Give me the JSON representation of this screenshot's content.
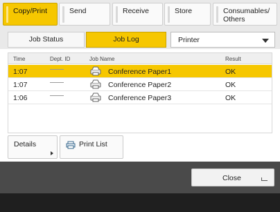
{
  "tabs": [
    {
      "label": "Copy/Print",
      "active": true
    },
    {
      "label": "Send",
      "active": false
    },
    {
      "label": "Receive",
      "active": false
    },
    {
      "label": "Store",
      "active": false
    },
    {
      "label": "Consumables/\nOthers",
      "active": false
    }
  ],
  "subtabs": {
    "job_status": "Job Status",
    "job_log": "Job Log",
    "printer_select": "Printer"
  },
  "table": {
    "headers": {
      "time": "Time",
      "dept": "Dept. ID",
      "job": "Job Name",
      "result": "Result"
    },
    "rows": [
      {
        "time": "1:07",
        "dept": "——",
        "job": "Conference Paper1",
        "result": "OK",
        "selected": true,
        "icon": "print-job-icon"
      },
      {
        "time": "1:07",
        "dept": "——",
        "job": "Conference Paper2",
        "result": "OK",
        "selected": false,
        "icon": "print-job-icon"
      },
      {
        "time": "1:06",
        "dept": "——",
        "job": "Conference Paper3",
        "result": "OK",
        "selected": false,
        "icon": "print-job-icon"
      }
    ]
  },
  "buttons": {
    "details": "Details",
    "print_list": "Print List",
    "close": "Close"
  },
  "colors": {
    "accent": "#f6c700",
    "footer": "#4a4a4a"
  }
}
